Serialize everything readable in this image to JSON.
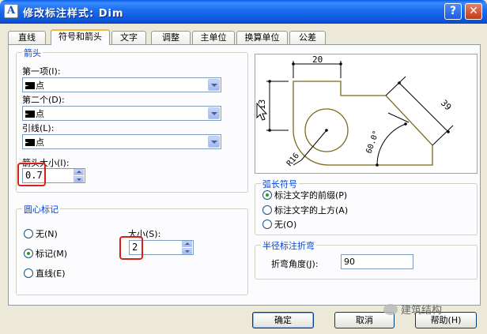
{
  "window": {
    "app_icon": "A",
    "title": "修改标注样式: Dim",
    "help_label": "?",
    "close_label": "✕"
  },
  "tabs": [
    {
      "label": "直线"
    },
    {
      "label": "符号和箭头",
      "active": true
    },
    {
      "label": "文字"
    },
    {
      "label": "调整"
    },
    {
      "label": "主单位"
    },
    {
      "label": "换算单位"
    },
    {
      "label": "公差"
    }
  ],
  "arrowheads": {
    "title": "箭头",
    "first_label": "第一项(I):",
    "first_value": "点",
    "second_label": "第二个(D):",
    "second_value": "点",
    "leader_label": "引线(L):",
    "leader_value": "点",
    "size_label": "箭头大小(I):",
    "size_value": "0.7"
  },
  "center_marks": {
    "title": "圆心标记",
    "options": [
      "无(N)",
      "标记(M)",
      "直线(E)"
    ],
    "selected": 1,
    "size_label": "大小(S):",
    "size_value": "2"
  },
  "preview": {
    "dim_top": "20",
    "dim_left": "13",
    "dim_right": "39",
    "angle": "60.0°",
    "radius": "R16"
  },
  "arc_length": {
    "title": "弧长符号",
    "options": [
      "标注文字的前缀(P)",
      "标注文字的上方(A)",
      "无(O)"
    ],
    "selected": 0
  },
  "radius_jog": {
    "title": "半径标注折弯",
    "angle_label": "折弯角度(J):",
    "angle_value": "90"
  },
  "buttons": {
    "ok": "确定",
    "cancel": "取消",
    "help": "帮助(H)"
  },
  "watermark": "建筑结构"
}
